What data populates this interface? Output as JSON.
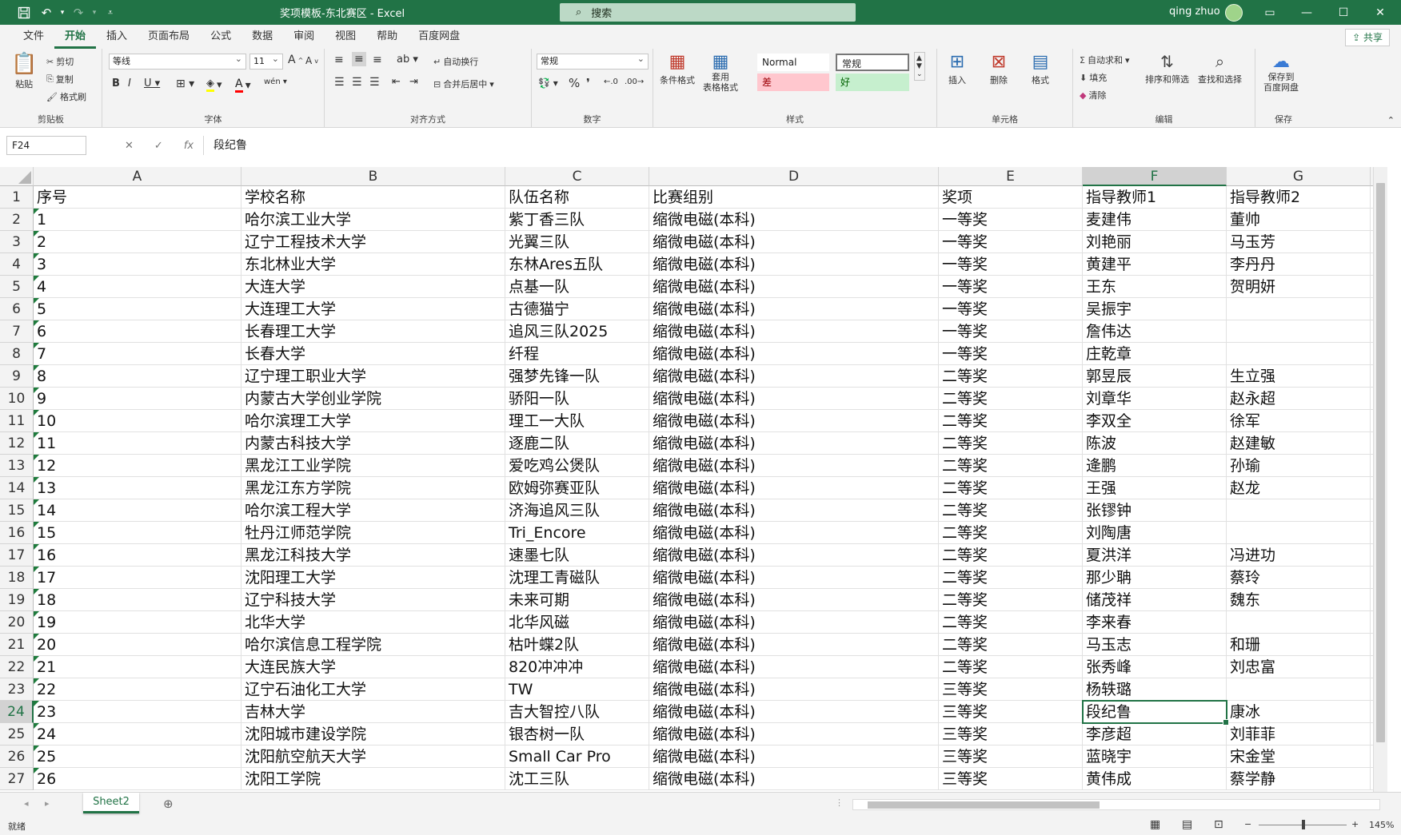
{
  "titlebar": {
    "filename": "奖项模板-东北赛区  -  Excel",
    "search": "搜索",
    "user": "qing zhuo"
  },
  "menu": [
    "文件",
    "开始",
    "插入",
    "页面布局",
    "公式",
    "数据",
    "审阅",
    "视图",
    "帮助",
    "百度网盘"
  ],
  "share": "共享",
  "ribbon": {
    "clipboard": {
      "paste": "粘贴",
      "cut": "剪切",
      "copy": "复制",
      "format_painter": "格式刷",
      "label": "剪贴板"
    },
    "font": {
      "name": "等线",
      "size": "11",
      "label": "字体"
    },
    "alignment": {
      "wrap": "自动换行",
      "merge": "合并后居中",
      "label": "对齐方式"
    },
    "number": {
      "format": "常规",
      "label": "数字"
    },
    "styles": {
      "conditional": "条件格式",
      "table": "套用\n表格格式",
      "normal": "Normal",
      "chang": "常规",
      "bad": "差",
      "good": "好",
      "label": "样式"
    },
    "cells": {
      "insert": "插入",
      "delete": "删除",
      "format": "格式",
      "label": "单元格"
    },
    "editing": {
      "autosum": "自动求和",
      "fill": "填充",
      "clear": "清除",
      "sort": "排序和筛选",
      "find": "查找和选择",
      "label": "编辑"
    },
    "save": {
      "save": "保存到\n百度网盘",
      "label": "保存"
    }
  },
  "formula": {
    "namebox": "F24",
    "content": "段纪鲁"
  },
  "columns": [
    "A",
    "B",
    "C",
    "D",
    "E",
    "F",
    "G"
  ],
  "rows": [
    [
      "序号",
      "学校名称",
      "队伍名称",
      "比赛组别",
      "奖项",
      "指导教师1",
      "指导教师2"
    ],
    [
      "1",
      "哈尔滨工业大学",
      "紫丁香三队",
      "缩微电磁(本科)",
      "一等奖",
      "麦建伟",
      "董帅"
    ],
    [
      "2",
      "辽宁工程技术大学",
      "光翼三队",
      "缩微电磁(本科)",
      "一等奖",
      "刘艳丽",
      "马玉芳"
    ],
    [
      "3",
      "东北林业大学",
      "东林Ares五队",
      "缩微电磁(本科)",
      "一等奖",
      "黄建平",
      "李丹丹"
    ],
    [
      "4",
      "大连大学",
      "点基一队",
      "缩微电磁(本科)",
      "一等奖",
      "王东",
      "贺明妍"
    ],
    [
      "5",
      "大连理工大学",
      "古德猫宁",
      "缩微电磁(本科)",
      "一等奖",
      "吴振宇",
      ""
    ],
    [
      "6",
      "长春理工大学",
      "追风三队2025",
      "缩微电磁(本科)",
      "一等奖",
      "詹伟达",
      ""
    ],
    [
      "7",
      "长春大学",
      "纤程",
      "缩微电磁(本科)",
      "一等奖",
      "庄乾章",
      ""
    ],
    [
      "8",
      "辽宁理工职业大学",
      "强梦先锋一队",
      "缩微电磁(本科)",
      "二等奖",
      "郭昱辰",
      "生立强"
    ],
    [
      "9",
      "内蒙古大学创业学院",
      "骄阳一队",
      "缩微电磁(本科)",
      "二等奖",
      "刘章华",
      "赵永超"
    ],
    [
      "10",
      "哈尔滨理工大学",
      "理工一大队",
      "缩微电磁(本科)",
      "二等奖",
      "李双全",
      "徐军"
    ],
    [
      "11",
      "内蒙古科技大学",
      "逐鹿二队",
      "缩微电磁(本科)",
      "二等奖",
      "陈波",
      "赵建敏"
    ],
    [
      "12",
      "黑龙江工业学院",
      "爱吃鸡公煲队",
      "缩微电磁(本科)",
      "二等奖",
      "逄鹏",
      "孙瑜"
    ],
    [
      "13",
      "黑龙江东方学院",
      "欧姆弥赛亚队",
      "缩微电磁(本科)",
      "二等奖",
      "王强",
      "赵龙"
    ],
    [
      "14",
      "哈尔滨工程大学",
      "济海追风三队",
      "缩微电磁(本科)",
      "二等奖",
      "张镠钟",
      ""
    ],
    [
      "15",
      "牡丹江师范学院",
      "Tri_Encore",
      "缩微电磁(本科)",
      "二等奖",
      "刘陶唐",
      ""
    ],
    [
      "16",
      "黑龙江科技大学",
      "速墨七队",
      "缩微电磁(本科)",
      "二等奖",
      "夏洪洋",
      "冯进功"
    ],
    [
      "17",
      "沈阳理工大学",
      "沈理工青磁队",
      "缩微电磁(本科)",
      "二等奖",
      "那少聃",
      "蔡玲"
    ],
    [
      "18",
      "辽宁科技大学",
      "未来可期",
      "缩微电磁(本科)",
      "二等奖",
      "储茂祥",
      "魏东"
    ],
    [
      "19",
      "北华大学",
      "北华风磁",
      "缩微电磁(本科)",
      "二等奖",
      "李来春",
      ""
    ],
    [
      "20",
      "哈尔滨信息工程学院",
      "枯叶蝶2队",
      "缩微电磁(本科)",
      "二等奖",
      "马玉志",
      "和珊"
    ],
    [
      "21",
      "大连民族大学",
      "820冲冲冲",
      "缩微电磁(本科)",
      "二等奖",
      "张秀峰",
      "刘忠富"
    ],
    [
      "22",
      "辽宁石油化工大学",
      "TW",
      "缩微电磁(本科)",
      "三等奖",
      "杨轶璐",
      ""
    ],
    [
      "23",
      "吉林大学",
      "吉大智控八队",
      "缩微电磁(本科)",
      "三等奖",
      "段纪鲁",
      "康冰"
    ],
    [
      "24",
      "沈阳城市建设学院",
      "银杏树一队",
      "缩微电磁(本科)",
      "三等奖",
      "李彦超",
      "刘菲菲"
    ],
    [
      "25",
      "沈阳航空航天大学",
      "Small Car Pro",
      "缩微电磁(本科)",
      "三等奖",
      "蓝晓宇",
      "宋金堂"
    ],
    [
      "26",
      "沈阳工学院",
      "沈工三队",
      "缩微电磁(本科)",
      "三等奖",
      "黄伟成",
      "蔡学静"
    ]
  ],
  "sheet_tab": "Sheet2",
  "status": {
    "ready": "就绪",
    "zoom": "145%"
  },
  "colors": {
    "accent": "#217346",
    "bad_bg": "#ffc7ce",
    "good_bg": "#c6efce"
  }
}
